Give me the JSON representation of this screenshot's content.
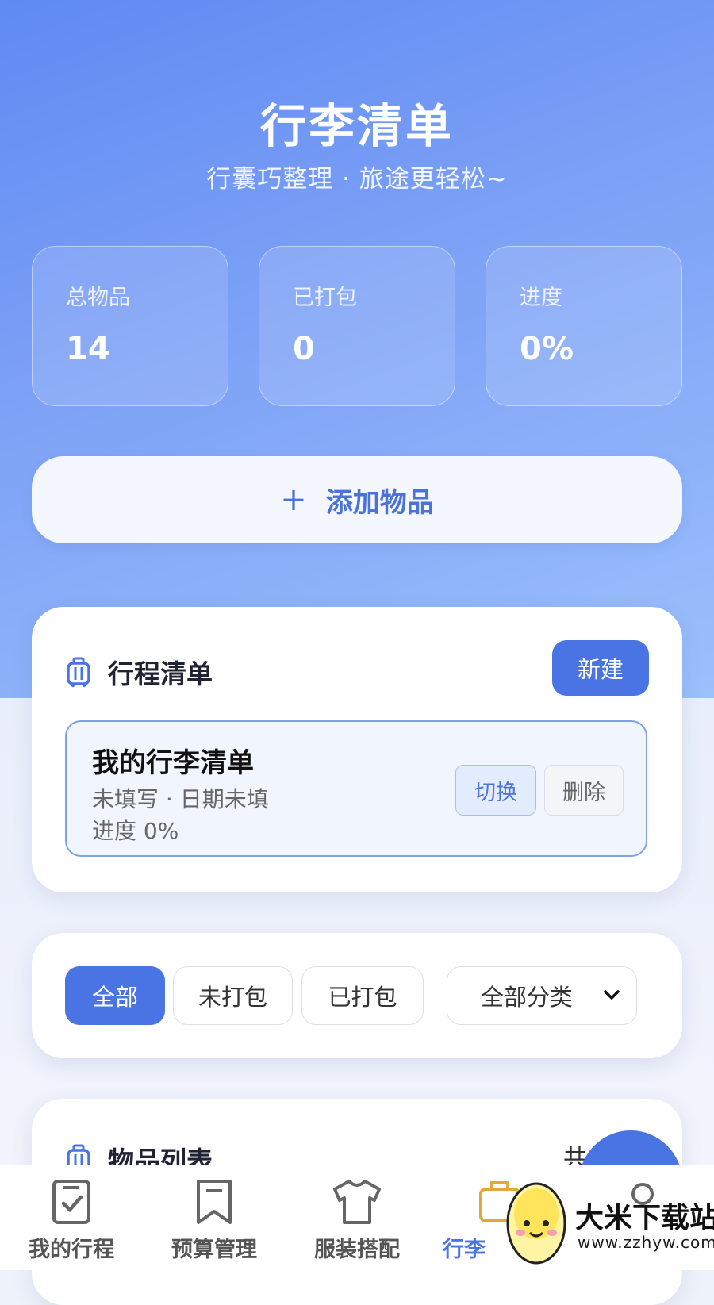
{
  "header": {
    "title": "行李清单",
    "subtitle": "行囊巧整理 · 旅途更轻松~"
  },
  "stats": [
    {
      "label": "总物品",
      "value": "14"
    },
    {
      "label": "已打包",
      "value": "0"
    },
    {
      "label": "进度",
      "value": "0%"
    }
  ],
  "add_button": {
    "icon": "plus-icon",
    "label": "添加物品"
  },
  "trip_card": {
    "icon": "luggage-icon",
    "title": "行程清单",
    "new_button": "新建",
    "list": {
      "name": "我的行李清单",
      "meta": "未填写 · 日期未填",
      "progress": "进度 0%",
      "switch_button": "切换",
      "delete_button": "删除"
    }
  },
  "filters": {
    "buttons": [
      {
        "label": "全部",
        "active": true
      },
      {
        "label": "未打包",
        "active": false
      },
      {
        "label": "已打包",
        "active": false
      }
    ],
    "category_select": "全部分类"
  },
  "items_card": {
    "icon": "luggage-icon",
    "title": "物品列表",
    "count_prefix": "共"
  },
  "tabbar": [
    {
      "label": "我的行程",
      "icon": "checklist-icon",
      "active": false
    },
    {
      "label": "预算管理",
      "icon": "bookmark-icon",
      "active": false
    },
    {
      "label": "服装搭配",
      "icon": "tshirt-icon",
      "active": false
    },
    {
      "label": "行李",
      "icon": "luggage-icon",
      "active": true
    },
    {
      "label": "",
      "icon": "profile-icon",
      "active": false
    }
  ],
  "watermark": {
    "text": "大米下载站",
    "url": "www.zzhyw.com"
  },
  "colors": {
    "accent": "#4a74e4",
    "hero_start": "#5f8af2",
    "hero_end": "#9cc0fb"
  }
}
